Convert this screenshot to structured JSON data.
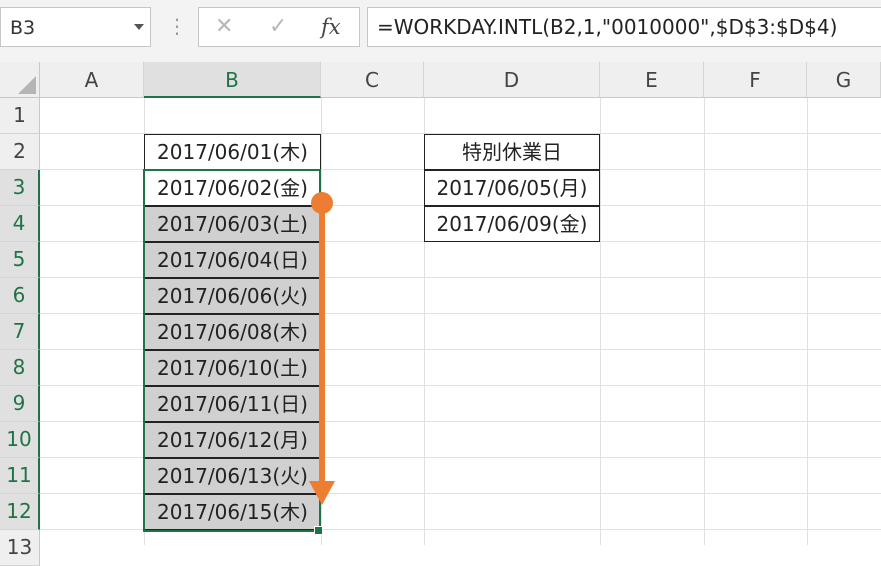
{
  "name_box": {
    "value": "B3"
  },
  "formula_bar": {
    "separator_glyph": "⋮",
    "cancel_glyph": "✕",
    "enter_glyph": "✓",
    "fx_glyph": "fx",
    "formula": "=WORKDAY.INTL(B2,1,\"0010000\",$D$3:$D$4)"
  },
  "columns": [
    "A",
    "B",
    "C",
    "D",
    "E",
    "F",
    "G"
  ],
  "rows": [
    "1",
    "2",
    "3",
    "4",
    "5",
    "6",
    "7",
    "8",
    "9",
    "10",
    "11",
    "12",
    "13"
  ],
  "column_b": {
    "b2": "2017/06/01(木)",
    "b3": "2017/06/02(金)",
    "b4": "2017/06/03(土)",
    "b5": "2017/06/04(日)",
    "b6": "2017/06/06(火)",
    "b7": "2017/06/08(木)",
    "b8": "2017/06/10(土)",
    "b9": "2017/06/11(日)",
    "b10": "2017/06/12(月)",
    "b11": "2017/06/13(火)",
    "b12": "2017/06/15(木)"
  },
  "holiday_table": {
    "header": "特別休業日",
    "d3": "2017/06/05(月)",
    "d4": "2017/06/09(金)"
  },
  "colors": {
    "selection": "#217346",
    "fill_arrow": "#ED7D31",
    "shaded_cell": "#D0D0D0"
  }
}
